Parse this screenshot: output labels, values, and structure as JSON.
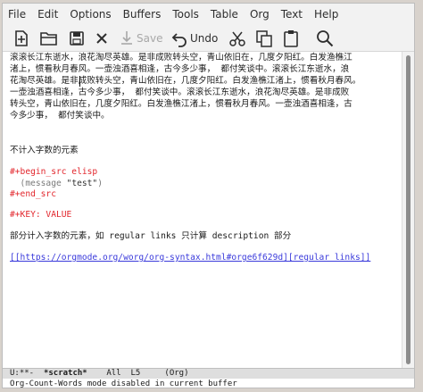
{
  "menubar": {
    "items": [
      "File",
      "Edit",
      "Options",
      "Buffers",
      "Tools",
      "Table",
      "Org",
      "Text",
      "Help"
    ]
  },
  "toolbar": {
    "new_icon": "new-file-icon",
    "open_icon": "open-folder-icon",
    "close_icon": "close-icon",
    "save_label": "Save",
    "save_icon": "save-icon",
    "undo_label": "Undo",
    "undo_icon": "undo-icon",
    "cut_icon": "scissors-icon",
    "copy_icon": "copy-icon",
    "paste_icon": "paste-icon",
    "search_icon": "search-icon"
  },
  "buffer": {
    "paragraph": [
      "滚滚长江东逝水，浪花淘尽英雄。是非成败转头空，青山依旧在，几度夕阳红。白发渔樵江",
      "渚上，惯看秋月春风。一壶浊酒喜相逢，古今多少事，  都付笑谈中。滚滚长江东逝水，浪",
      "花淘尽英雄。是非成败转头空，青山依旧在，几度夕阳红。白发渔樵江渚上，惯看秋月春风。",
      "一壶浊酒喜相逢，古今多少事，  都付笑谈中。滚滚长江东逝水，浪花淘尽英雄。是非成败",
      "转头空，青山依旧在，几度夕阳红。白发渔樵江渚上，惯看秋月春风。一壶浊酒喜相逢，古",
      "今多少事，  都付笑谈中。"
    ],
    "heading1": "不计入字数的元素",
    "begin_src": "#+begin_src elisp",
    "src_open": "  (message ",
    "src_string": "\"test\"",
    "src_close": ")",
    "end_src": "#+end_src",
    "key_line": "#+KEY: VALUE",
    "heading2": "部分计入字数的元素，如 regular links 只计算 description 部分",
    "link_text": "[[https://orgmode.org/worg/org-syntax.html#orge6f629d][regular links]]"
  },
  "modeline": {
    "status": "U:**-  ",
    "buffer_name": "*scratch*",
    "position": "    All  L5     (Org)"
  },
  "echo_area": {
    "message": "Org-Count-Words mode disabled in current buffer"
  },
  "colors": {
    "keyword": "#e2262c",
    "link": "#3a3adb",
    "modeline_bg": "#dedede"
  }
}
